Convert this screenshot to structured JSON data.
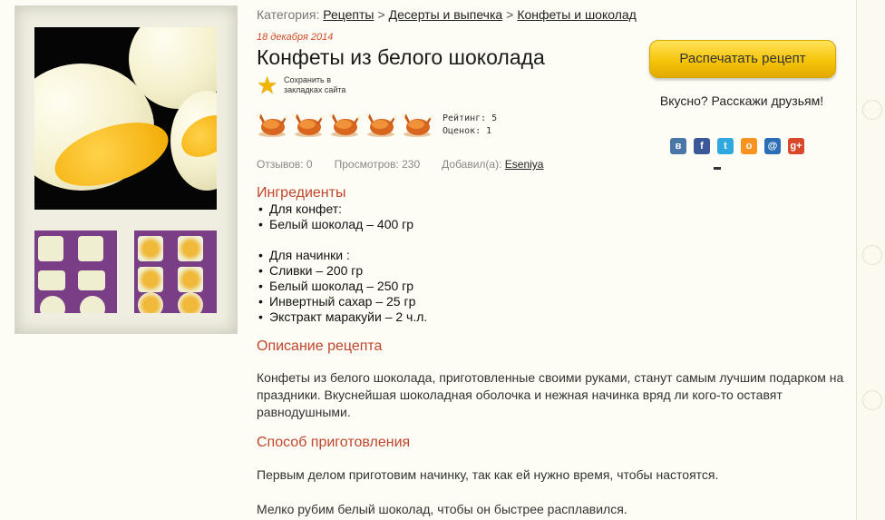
{
  "breadcrumb": {
    "label": "Категория:",
    "items": [
      "Рецепты",
      "Десерты и выпечка",
      "Конфеты и шоколад"
    ],
    "separator": ">"
  },
  "recipe": {
    "date": "18 декабря 2014",
    "title": "Конфеты из белого шоколада",
    "bookmark_label": "Сохранить в закладках сайта",
    "rating_value": 5,
    "rating_label": "Рейтинг: 5",
    "votes_label": "Оценок: 1",
    "stats": {
      "reviews": "Отзывов: 0",
      "views": "Просмотров: 230",
      "added_by_label": "Добавил(а):",
      "author": "Eseniya"
    }
  },
  "sidebar": {
    "print_button": "Распечатать рецепт",
    "share_text": "Вкусно? Расскажи друзьям!",
    "share_icons": [
      {
        "name": "vkontakte-icon",
        "glyph": "в",
        "color": "#4a76a8"
      },
      {
        "name": "facebook-icon",
        "glyph": "f",
        "color": "#3b5998"
      },
      {
        "name": "twitter-icon",
        "glyph": "t",
        "color": "#2fa8e0"
      },
      {
        "name": "odnoklassniki-icon",
        "glyph": "о",
        "color": "#f7931e"
      },
      {
        "name": "mailru-icon",
        "glyph": "@",
        "color": "#2b6eb5"
      },
      {
        "name": "googleplus-icon",
        "glyph": "g+",
        "color": "#d9482b"
      }
    ]
  },
  "ingredients": {
    "heading": "Ингредиенты",
    "items": [
      "Для конфет:",
      "Белый шоколад – 400 гр",
      "",
      "Для начинки :",
      "Сливки – 200 гр",
      "Белый шоколад – 250 гр",
      "Инвертный сахар – 25 гр",
      "Экстракт маракуйи – 2 ч.л."
    ]
  },
  "description": {
    "heading": "Описание рецепта",
    "text": "Конфеты из белого шоколада, приготовленные своими руками, станут самым лучшим подарком на праздники. Вкуснейшая шоколадная оболочка и нежная начинка вряд ли кого-то оставят равнодушными."
  },
  "method": {
    "heading": "Способ приготовления",
    "steps": [
      "Первым делом приготовим начинку, так как ей нужно время, чтобы настоятся.",
      "Мелко рубим белый шоколад, чтобы он быстрее расплавился."
    ]
  },
  "colors": {
    "accent": "#c0452c",
    "date": "#d04a2a",
    "button": "#f5c40a",
    "background": "#fdfdf5"
  }
}
